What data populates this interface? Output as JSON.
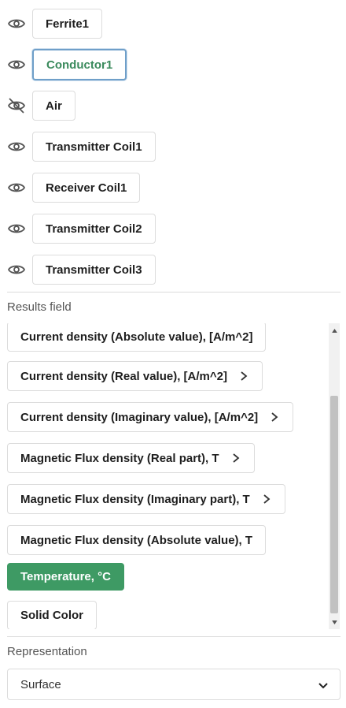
{
  "objects": [
    {
      "label": "Ferrite1",
      "visible": true,
      "selected": false
    },
    {
      "label": "Conductor1",
      "visible": true,
      "selected": true
    },
    {
      "label": "Air",
      "visible": false,
      "selected": false
    },
    {
      "label": "Transmitter Coil1",
      "visible": true,
      "selected": false
    },
    {
      "label": "Receiver Coil1",
      "visible": true,
      "selected": false
    },
    {
      "label": "Transmitter Coil2",
      "visible": true,
      "selected": false
    },
    {
      "label": "Transmitter Coil3",
      "visible": true,
      "selected": false
    }
  ],
  "results_field": {
    "label": "Results field",
    "items": [
      {
        "label": "Current density (Absolute value), [A/m^2]",
        "has_submenu": false,
        "active": false
      },
      {
        "label": "Current density (Real value), [A/m^2]",
        "has_submenu": true,
        "active": false
      },
      {
        "label": "Current density (Imaginary value), [A/m^2]",
        "has_submenu": true,
        "active": false
      },
      {
        "label": "Magnetic Flux density (Real part), T",
        "has_submenu": true,
        "active": false
      },
      {
        "label": "Magnetic Flux density (Imaginary part), T",
        "has_submenu": true,
        "active": false
      },
      {
        "label": "Magnetic Flux density (Absolute value), T",
        "has_submenu": false,
        "active": false
      },
      {
        "label": "Temperature, °C",
        "has_submenu": false,
        "active": true
      },
      {
        "label": "Solid Color",
        "has_submenu": false,
        "active": false
      }
    ]
  },
  "representation": {
    "label": "Representation",
    "value": "Surface"
  },
  "colors": {
    "active_green": "#3e9a64",
    "selected_text": "#3a8a5c",
    "selected_border": "#6f9fc9"
  }
}
